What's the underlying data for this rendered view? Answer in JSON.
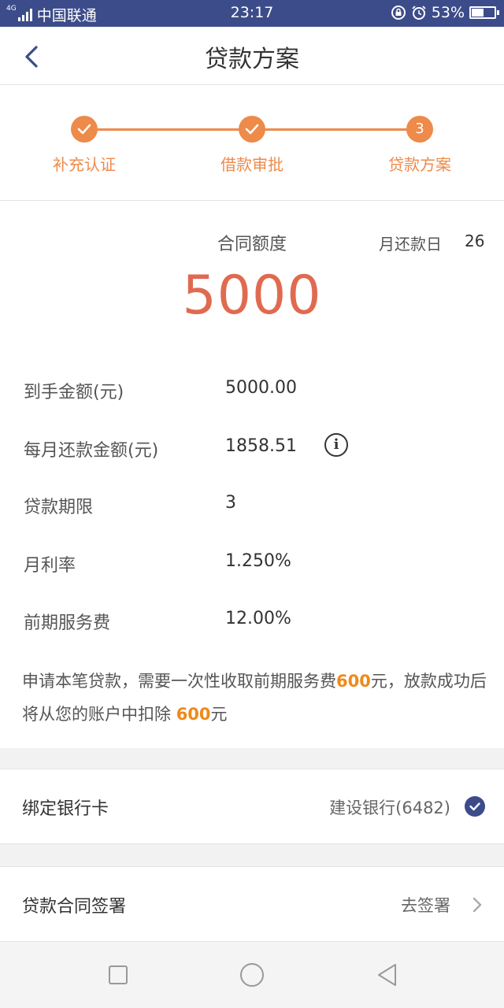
{
  "status_bar": {
    "network_tag": "4G",
    "carrier": "中国联通",
    "time": "23:17",
    "battery": "53%",
    "icons": [
      "signal-icon",
      "lock-rotation-icon",
      "alarm-icon",
      "battery-icon"
    ]
  },
  "header": {
    "title": "贷款方案",
    "back_icon": "chevron-left-icon"
  },
  "steps": [
    {
      "label": "补充认证",
      "marker": "✓",
      "status": "done"
    },
    {
      "label": "借款审批",
      "marker": "✓",
      "status": "done"
    },
    {
      "label": "贷款方案",
      "marker": "3",
      "status": "current"
    }
  ],
  "summary": {
    "contract_label": "合同额度",
    "amount": "5000",
    "repay_day_label": "月还款日",
    "repay_day_value": "26"
  },
  "details": [
    {
      "label": "到手金额(元)",
      "value": "5000.00"
    },
    {
      "label": "每月还款金额(元)",
      "value": "1858.51"
    },
    {
      "label": "贷款期限",
      "value": "3"
    },
    {
      "label": "月利率",
      "value": "1.250%"
    },
    {
      "label": "前期服务费",
      "value": "12.00%"
    }
  ],
  "notice": {
    "part1": "申请本笔贷款，需要一次性收取前期服务费",
    "fee1": "600",
    "part2": "元，放款成功后将从您的账户中扣除 ",
    "fee2": "600",
    "part3": "元"
  },
  "bank_card": {
    "label": "绑定银行卡",
    "value": "建设银行(6482)"
  },
  "contract_sign": {
    "label": "贷款合同签署",
    "value": "去签署"
  },
  "colors": {
    "brand": "#3c4c8a",
    "accent_orange": "#ee8a4a",
    "amount_red": "#e06a50",
    "highlight": "#ee8a1a"
  }
}
